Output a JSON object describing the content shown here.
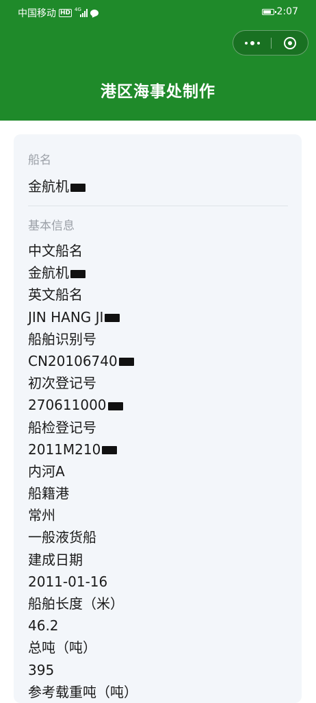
{
  "status_bar": {
    "carrier": "中国移动",
    "hd": "HD",
    "network": "4G",
    "time": "2:07"
  },
  "capsule": {
    "more_icon": "more-dots-icon",
    "close_icon": "close-circle-icon"
  },
  "header": {
    "title": "港区海事处制作"
  },
  "vessel": {
    "name_label": "船名",
    "name_value": "金航机",
    "basic_info_label": "基本信息",
    "lines": [
      "中文船名",
      "金航机",
      "英文船名",
      "JIN HANG JI",
      "船舶识别号",
      "CN20106740",
      "初次登记号",
      "270611000",
      "船检登记号",
      "2011M210",
      "内河A",
      "船籍港",
      "常州",
      "一般液货船",
      "建成日期",
      "2011-01-16",
      "船舶长度（米）",
      "46.2",
      "总吨（吨）",
      "395",
      "参考载重吨（吨）"
    ]
  },
  "colors": {
    "header_bg": "#1f8a2a",
    "card_bg": "#f3f6fa",
    "label_color": "#9a9fa6"
  }
}
